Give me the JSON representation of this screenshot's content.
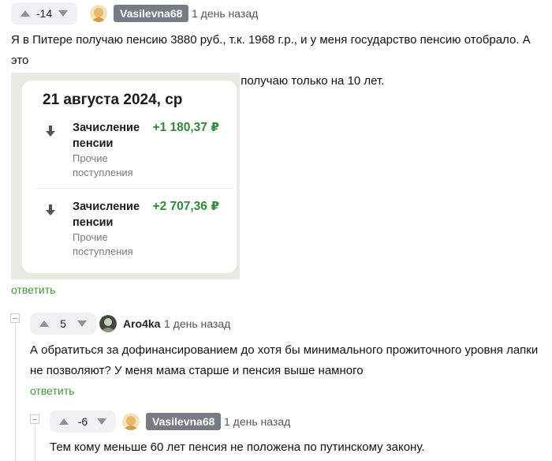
{
  "comments": [
    {
      "author": "Vasilevna68",
      "time": "1 день назад",
      "score": "-14",
      "text_lines": [
        "Я в Питере получаю пенсию 3880 руб., т.к. 1968 г.р., и у меня государство пенсию отобрало. А это",
        "за программу софинансирования пенсии получаю только на 10 лет."
      ],
      "reply_label": "ответить",
      "attachment": {
        "date": "21 августа 2024, ср",
        "operations": [
          {
            "title_1": "Зачисление",
            "title_2": "пенсии",
            "sub_1": "Прочие",
            "sub_2": "поступления",
            "amount": "+1 180,37 ₽"
          },
          {
            "title_1": "Зачисление",
            "title_2": "пенсии",
            "sub_1": "Прочие",
            "sub_2": "поступления",
            "amount": "+2 707,36 ₽"
          }
        ]
      }
    },
    {
      "author": "Aro4ka",
      "time": "1 день назад",
      "score": "5",
      "text_lines": [
        "А обратиться за дофинансированием до хотя бы минимального прожиточного уровня лапки",
        "не позволяют? У меня мама старше и пенсия выше намного"
      ],
      "reply_label": "ответить"
    },
    {
      "author": "Vasilevna68",
      "time": "1 день назад",
      "score": "-6",
      "text_lines": [
        "Тем кому меньше 60 лет пенсия не положена по путинскому закону."
      ]
    }
  ],
  "colors": {
    "reply": "#3d9b34",
    "author_badge": "#767b85",
    "amount": "#2e8b3a"
  }
}
